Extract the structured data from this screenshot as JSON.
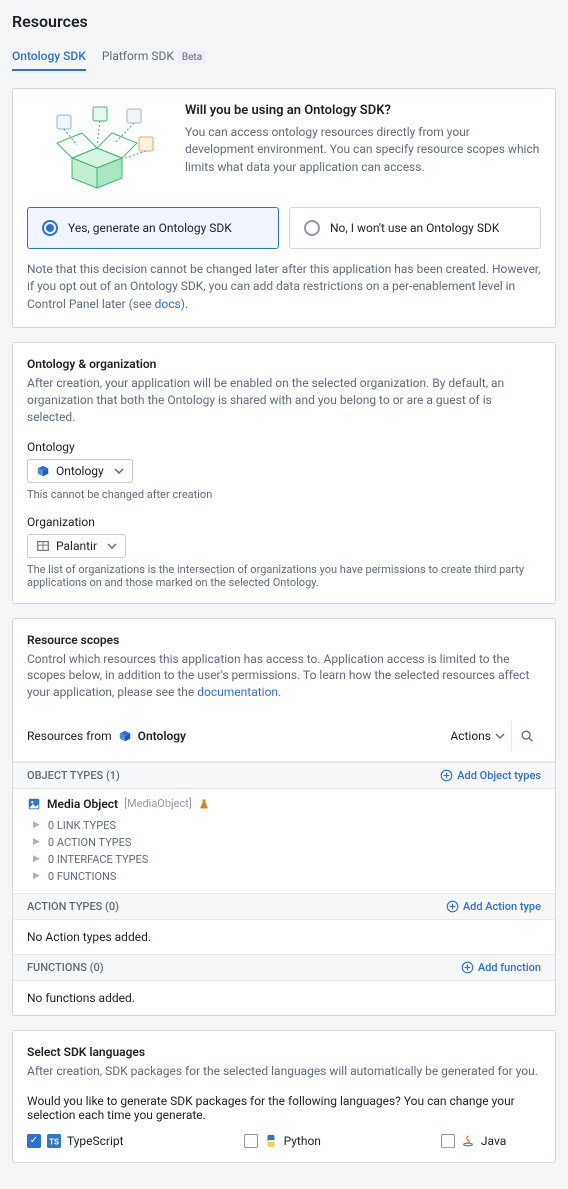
{
  "page": {
    "title": "Resources"
  },
  "tabs": {
    "ontology": "Ontology SDK",
    "platform": "Platform SDK",
    "platform_badge": "Beta"
  },
  "intro": {
    "heading": "Will you be using an Ontology SDK?",
    "body": "You can access ontology resources directly from your development environment. You can specify resource scopes which limits what data your application can access.",
    "yes": "Yes, generate an Ontology SDK",
    "no": "No, I won't use an Ontology SDK",
    "note_pre": "Note that this decision cannot be changed later after this application has been created. However, if you opt out of an Ontology SDK, you can add data restrictions on a per-enablement level in Control Panel later (see ",
    "note_link": "docs",
    "note_post": ")."
  },
  "org": {
    "title": "Ontology & organization",
    "desc": "After creation, your application will be enabled on the selected organization. By default, an organization that both the Ontology is shared with and you belong to or are a guest of is selected.",
    "ontology_label": "Ontology",
    "ontology_value": "Ontology",
    "ontology_hint": "This cannot be changed after creation",
    "org_label": "Organization",
    "org_value": "Palantir",
    "org_hint": "The list of organizations is the intersection of organizations you have permissions to create third party applications on and those marked on the selected Ontology."
  },
  "scopes": {
    "title": "Resource scopes",
    "desc_pre": "Control which resources this application has access to. Application access is limited to the scopes below, in addition to the user's permissions. To learn how the selected resources affect your application, please see the ",
    "desc_link": "documentation",
    "desc_post": ".",
    "resources_from": "Resources from",
    "ontology_name": "Ontology",
    "actions_btn": "Actions",
    "object_types_header": "OBJECT TYPES (1)",
    "add_object_types": "Add Object types",
    "media_object": "Media Object",
    "media_object_api": "[MediaObject]",
    "tree": {
      "link": "0 LINK TYPES",
      "action": "0 ACTION TYPES",
      "interface": "0 INTERFACE TYPES",
      "functions": "0 FUNCTIONS"
    },
    "action_types_header": "ACTION TYPES (0)",
    "add_action_type": "Add Action type",
    "no_action": "No Action types added.",
    "functions_header": "FUNCTIONS (0)",
    "add_function": "Add function",
    "no_functions": "No functions added."
  },
  "langs": {
    "title": "Select SDK languages",
    "desc": "After creation, SDK packages for the selected languages will automatically be generated for you.",
    "question": "Would you like to generate SDK packages for the following languages? You can change your selection each time you generate.",
    "typescript": "TypeScript",
    "python": "Python",
    "java": "Java"
  }
}
